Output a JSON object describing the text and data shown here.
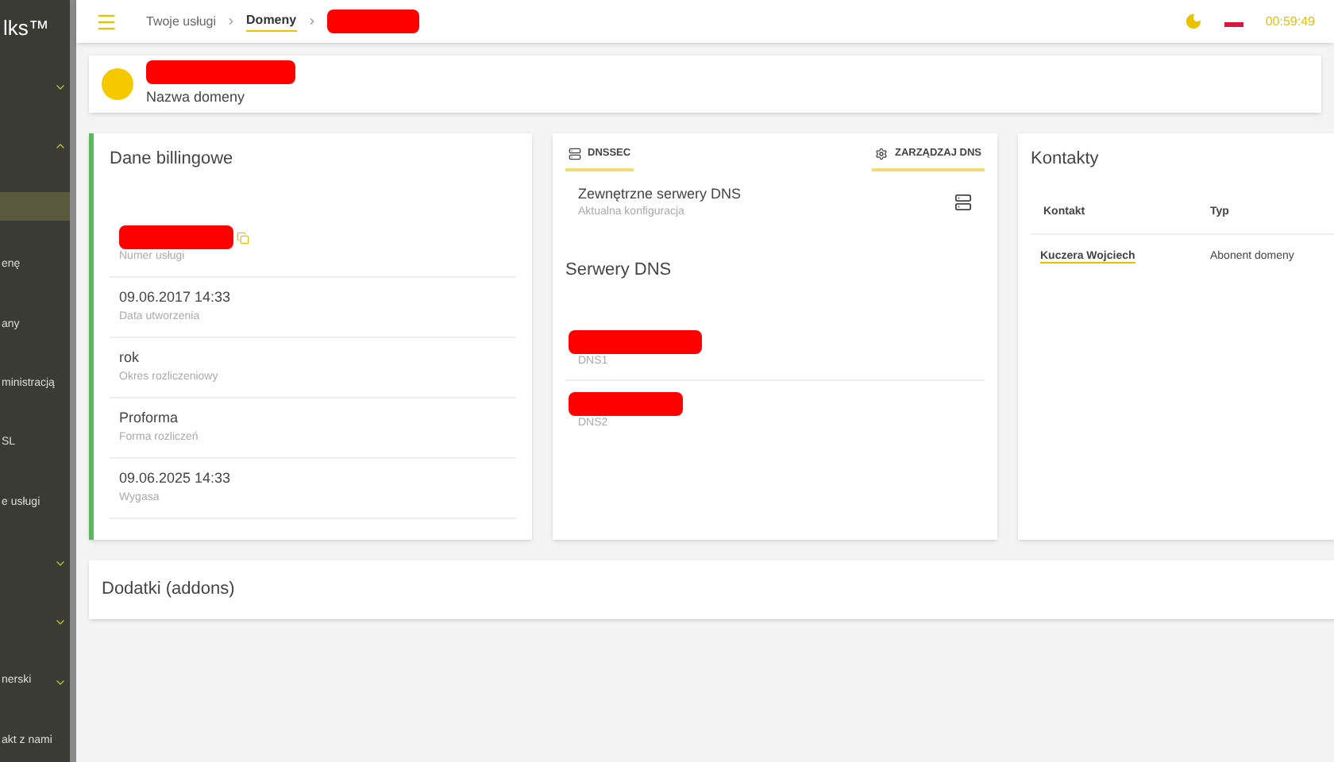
{
  "sidebar": {
    "logo": "lks™",
    "items": [
      {
        "kind": "group",
        "expanded": false,
        "selected": false
      },
      {
        "kind": "group",
        "expanded": true,
        "selected": false
      },
      {
        "kind": "link",
        "selected": true
      },
      {
        "kind": "link",
        "label": "enę",
        "selected": false
      },
      {
        "kind": "link",
        "label": "any",
        "selected": false
      },
      {
        "kind": "link",
        "label": "ministracją",
        "selected": false
      },
      {
        "kind": "link",
        "label": "SL",
        "selected": false
      },
      {
        "kind": "link",
        "label": "e usługi",
        "selected": false
      },
      {
        "kind": "group",
        "expanded": false,
        "selected": false
      },
      {
        "kind": "group",
        "expanded": false,
        "selected": false
      },
      {
        "kind": "group",
        "label": "nerski",
        "expanded": false,
        "selected": false
      },
      {
        "kind": "link",
        "label": "akt z nami",
        "selected": false
      }
    ]
  },
  "header": {
    "breadcrumbs": [
      {
        "label": "Twoje usługi",
        "selected": false
      },
      {
        "label": "Domeny",
        "selected": true
      }
    ],
    "time": "00:59:49"
  },
  "domain": {
    "label": "Nazwa domeny"
  },
  "billing": {
    "title": "Dane billingowe",
    "fields": [
      {
        "label": "Numer usługi",
        "copyable": true
      },
      {
        "value": "09.06.2017 14:33",
        "label": "Data utworzenia",
        "copyable": false
      },
      {
        "value": "rok",
        "label": "Okres rozliczeniowy",
        "copyable": false
      },
      {
        "value": "Proforma",
        "label": "Forma rozliczeń",
        "copyable": false
      },
      {
        "value": "09.06.2025 14:33",
        "label": "Wygasa",
        "copyable": false
      }
    ]
  },
  "dns": {
    "buttons": [
      {
        "label": "DNSSEC",
        "kind": "server"
      },
      {
        "label": "ZARZĄDZAJ DNS",
        "kind": "gear"
      }
    ],
    "config": {
      "title": "Zewnętrzne serwery DNS",
      "subtitle": "Aktualna konfiguracja"
    },
    "servers_title": "Serwery DNS",
    "servers": [
      {
        "label": "DNS1"
      },
      {
        "label": "DNS2"
      }
    ]
  },
  "contacts": {
    "title": "Kontakty",
    "columns": [
      "Kontakt",
      "Typ"
    ],
    "rows": [
      {
        "name": "Kuczera Wojciech",
        "type": "Abonent domeny"
      }
    ]
  },
  "addons": {
    "title": "Dodatki (addons)"
  }
}
